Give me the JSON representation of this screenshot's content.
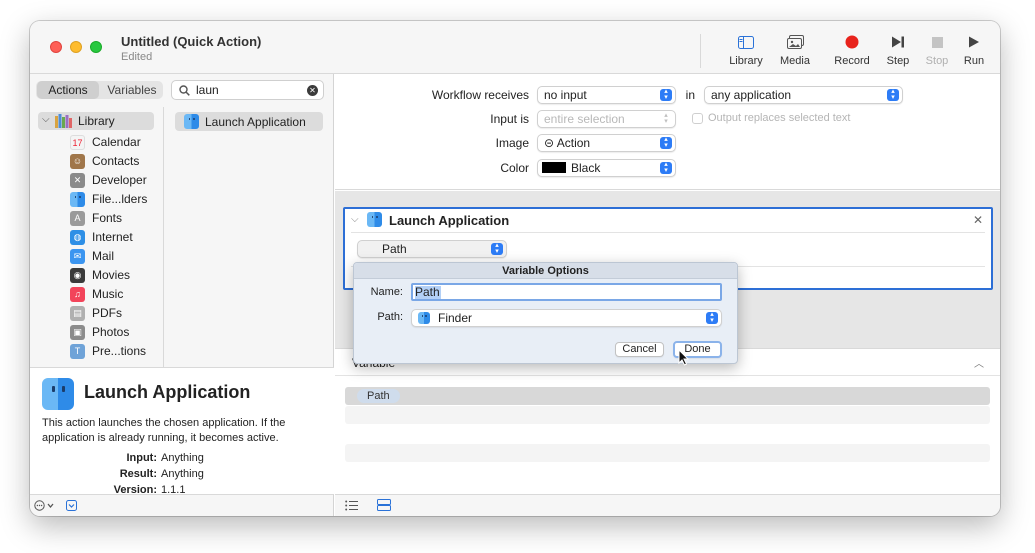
{
  "window": {
    "title": "Untitled (Quick Action)",
    "subtitle": "Edited"
  },
  "toolbar": {
    "library": "Library",
    "media": "Media",
    "record": "Record",
    "step": "Step",
    "stop": "Stop",
    "run": "Run",
    "record_color": "#e8231c"
  },
  "left_pane": {
    "tabs": {
      "actions": "Actions",
      "variables": "Variables"
    },
    "search": {
      "value": "laun"
    },
    "library_root": "Library",
    "categories": [
      {
        "label": "Calendar",
        "icon": "calendar-icon",
        "color": "#f4f4f4"
      },
      {
        "label": "Contacts",
        "icon": "contacts-icon",
        "color": "#a0764a"
      },
      {
        "label": "Developer",
        "icon": "developer-icon",
        "color": "#8a8a8a"
      },
      {
        "label": "File...lders",
        "icon": "finder-icon",
        "color": "#3a8ef0"
      },
      {
        "label": "Fonts",
        "icon": "fonts-icon",
        "color": "#9a9a9a"
      },
      {
        "label": "Internet",
        "icon": "internet-icon",
        "color": "#2e8fe6"
      },
      {
        "label": "Mail",
        "icon": "mail-icon",
        "color": "#3b95f0"
      },
      {
        "label": "Movies",
        "icon": "movies-icon",
        "color": "#3a3a3a"
      },
      {
        "label": "Music",
        "icon": "music-icon",
        "color": "#f2445a"
      },
      {
        "label": "PDFs",
        "icon": "pdfs-icon",
        "color": "#b0b0b0"
      },
      {
        "label": "Photos",
        "icon": "photos-icon",
        "color": "#8c8c8c"
      },
      {
        "label": "Pre...tions",
        "icon": "presentations-icon",
        "color": "#6fa3d8"
      }
    ],
    "action_result": "Launch Application"
  },
  "description": {
    "title": "Launch Application",
    "text": "This action launches the chosen application. If the application is already running, it becomes active.",
    "input_label": "Input:",
    "input_value": "Anything",
    "result_label": "Result:",
    "result_value": "Anything",
    "version_label": "Version:",
    "version_value": "1.1.1"
  },
  "workflow": {
    "receives_label": "Workflow receives",
    "receives_value": "no input",
    "in_label": "in",
    "app_value": "any application",
    "input_is_label": "Input is",
    "input_is_value": "entire selection",
    "output_replaces": "Output replaces selected text",
    "image_label": "Image",
    "image_value": "⊝ Action",
    "color_label": "Color",
    "color_value": "Black"
  },
  "action_card": {
    "title": "Launch Application",
    "path_popup": "Path"
  },
  "variables_panel": {
    "header": "Variable",
    "rows": [
      "Path"
    ]
  },
  "sheet": {
    "title": "Variable Options",
    "name_label": "Name:",
    "name_value": "Path",
    "path_label": "Path:",
    "path_value": "Finder",
    "cancel": "Cancel",
    "done": "Done"
  }
}
